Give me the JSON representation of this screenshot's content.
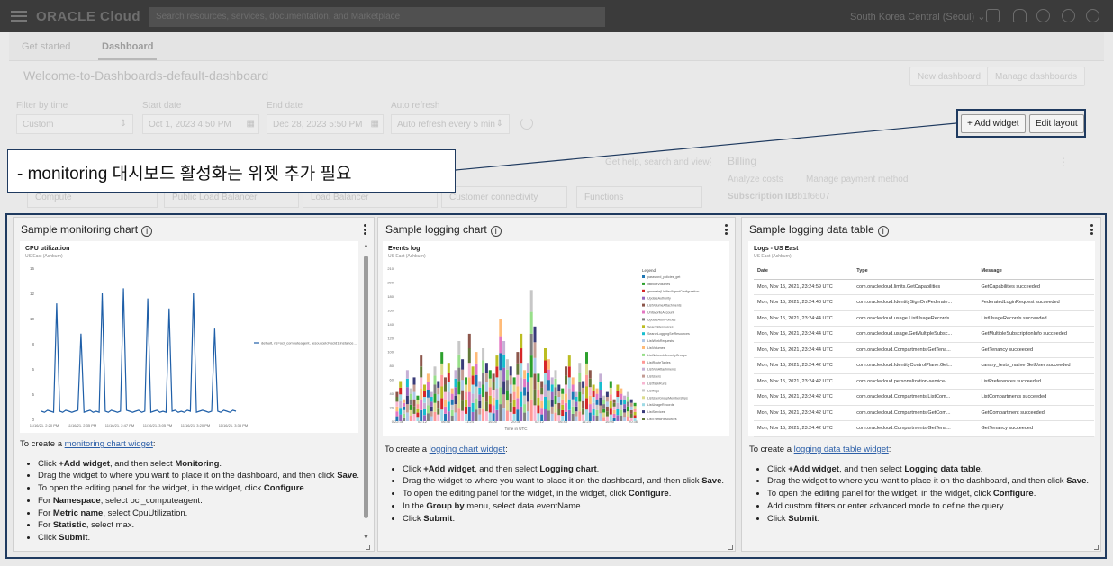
{
  "header": {
    "logo": "ORACLE Cloud",
    "search_placeholder": "Search resources, services, documentation, and Marketplace",
    "region": "South Korea Central (Seoul)"
  },
  "tabs": [
    "Get started",
    "Dashboard"
  ],
  "dashboard": {
    "title": "Welcome-to-Dashboards-default-dashboard",
    "new_dashboard_label": "New dashboard",
    "manage_dashboards_label": "Manage dashboards"
  },
  "filters": {
    "filter_by_time_label": "Filter by time",
    "filter_by_time_value": "Custom",
    "start_date_label": "Start date",
    "start_date_value": "Oct 1, 2023 4:50 PM",
    "end_date_label": "End date",
    "end_date_value": "Dec 28, 2023 5:50 PM",
    "auto_refresh_label": "Auto refresh",
    "auto_refresh_value": "Auto refresh every 5 min"
  },
  "toolbar": {
    "add_widget_label": "+ Add widget",
    "edit_layout_label": "Edit layout"
  },
  "callout": {
    "text": "- monitoring 대시보드 활성화는 위젯 추가 필요"
  },
  "background": {
    "link_text": "Get help, search and view",
    "billing_title": "Billing",
    "analyze_costs": "Analyze costs",
    "manage_payment": "Manage payment method",
    "subscription_label": "Subscription ID:",
    "subscription_value": "8b1f6607",
    "boxes": [
      "Compute",
      "Public Load Balancer",
      "Load Balancer",
      "Customer connectivity",
      "Functions"
    ]
  },
  "widgets": {
    "monitoring": {
      "title": "Sample monitoring chart",
      "chart_title": "CPU utilization",
      "chart_sub": "US East (Ashburn)",
      "legend": "default, ns=oci_computeagent, resourceId=ocid1.instance...",
      "yticks": [
        "15",
        "12",
        "10",
        "8",
        "6",
        "5",
        "0"
      ],
      "xticks": [
        "11/16/21, 2:20 PM",
        "11/16/21, 2:35 PM",
        "11/16/21, 2:47 PM",
        "11/16/21, 3:05 PM",
        "11/16/21, 3:20 PM",
        "11/16/21, 3:35 PM"
      ],
      "instructions_intro": "To create a ",
      "instructions_link": "monitoring chart widget",
      "instructions_colon": ":",
      "steps": [
        {
          "pre": "Click ",
          "b": "+Add widget",
          "post": ", and then select ",
          "b2": "Monitoring",
          "post2": "."
        },
        {
          "pre": "Drag the widget to where you want to place it on the dashboard, and then click ",
          "b": "Save",
          "post": ".",
          "b2": "",
          "post2": ""
        },
        {
          "pre": "To open the editing panel for the widget, in the widget, click ",
          "b": "Configure",
          "post": ".",
          "b2": "",
          "post2": ""
        },
        {
          "pre": "For ",
          "b": "Namespace",
          "post": ", select oci_computeagent.",
          "b2": "",
          "post2": ""
        },
        {
          "pre": "For ",
          "b": "Metric name",
          "post": ", select CpuUtilization.",
          "b2": "",
          "post2": ""
        },
        {
          "pre": "For ",
          "b": "Statistic",
          "post": ", select max.",
          "b2": "",
          "post2": ""
        },
        {
          "pre": "Click ",
          "b": "Submit",
          "post": ".",
          "b2": "",
          "post2": ""
        }
      ]
    },
    "logging": {
      "title": "Sample logging chart",
      "chart_title": "Events log",
      "chart_sub": "US East (Ashburn)",
      "legend_title": "Legend",
      "legend_items": [
        {
          "label": "password_policies_get",
          "color": "#1f77b4"
        },
        {
          "label": "listbootVolumes",
          "color": "#2ca02c"
        },
        {
          "label": "generate(UnifiedAgentConfiguration",
          "color": "#d62728"
        },
        {
          "label": "UpdateAuthority",
          "color": "#9467bd"
        },
        {
          "label": "ListVolumeAttachments",
          "color": "#8c564b"
        },
        {
          "label": "UnfavoriteAccount",
          "color": "#e377c2"
        },
        {
          "label": "UpdateAuthPolicies",
          "color": "#7f7f7f"
        },
        {
          "label": "SearchResources",
          "color": "#bcbd22"
        },
        {
          "label": "SearchLoggingSetResources",
          "color": "#17becf"
        },
        {
          "label": "ListWorkRequests",
          "color": "#aec7e8"
        },
        {
          "label": "ListVolumes",
          "color": "#ffbb78"
        },
        {
          "label": "ListNetworkSecurityGroups",
          "color": "#98df8a"
        },
        {
          "label": "ListRouteTables",
          "color": "#ff9896"
        },
        {
          "label": "ListVcnAttachments",
          "color": "#c5b0d5"
        },
        {
          "label": "ListUsers",
          "color": "#c49c94"
        },
        {
          "label": "ListTaskRuns",
          "color": "#f7b6d2"
        },
        {
          "label": "ListTags",
          "color": "#c7c7c7"
        },
        {
          "label": "ListUserGroupMemberships",
          "color": "#dbdb8d"
        },
        {
          "label": "ListUsageRecords",
          "color": "#9edae5"
        },
        {
          "label": "ListServices",
          "color": "#393b79"
        },
        {
          "label": "ListTrafficResources",
          "color": "#637939"
        }
      ],
      "yticks": [
        "210",
        "200",
        "180",
        "160",
        "140",
        "120",
        "100",
        "80",
        "60",
        "40",
        "20",
        "0"
      ],
      "xticks": [
        "22:36",
        "02:12",
        "06:48",
        "11:24",
        "16:00",
        "20:36",
        "02:12",
        "06:48",
        "11:24",
        "16:00",
        "20:36"
      ],
      "xlabel": "Time in UTC",
      "instructions_intro": "To create a ",
      "instructions_link": "logging chart widget",
      "instructions_colon": ":",
      "steps": [
        {
          "pre": "Click ",
          "b": "+Add widget",
          "post": ", and then select ",
          "b2": "Logging chart",
          "post2": "."
        },
        {
          "pre": "Drag the widget to where you want to place it on the dashboard, and then click ",
          "b": "Save",
          "post": ".",
          "b2": "",
          "post2": ""
        },
        {
          "pre": "To open the editing panel for the widget, in the widget, click ",
          "b": "Configure",
          "post": ".",
          "b2": "",
          "post2": ""
        },
        {
          "pre": "In the ",
          "b": "Group by",
          "post": " menu, select data.eventName.",
          "b2": "",
          "post2": ""
        },
        {
          "pre": "Click ",
          "b": "Submit",
          "post": ".",
          "b2": "",
          "post2": ""
        }
      ]
    },
    "table": {
      "title": "Sample logging data table",
      "chart_title": "Logs - US East",
      "chart_sub": "US East (Ashburn)",
      "columns": [
        "Date",
        "Type",
        "Message"
      ],
      "rows": [
        [
          "Mon, Nov 15, 2021, 23:24:59 UTC",
          "com.oraclecloud.limits.GetCapabilities",
          "GetCapabilities succeeded"
        ],
        [
          "Mon, Nov 15, 2021, 23:24:48 UTC",
          "com.oraclecloud.IdentitySignOn.Federate...",
          "FederatedLoginRequest succeeded"
        ],
        [
          "Mon, Nov 15, 2021, 23:24:44 UTC",
          "com.oraclecloud.usage.ListUsageRecords",
          "ListUsageRecords succeeded"
        ],
        [
          "Mon, Nov 15, 2021, 23:24:44 UTC",
          "com.oraclecloud.usage.GetMultipleSubsc...",
          "GetMultipleSubscriptionInfo succeeded"
        ],
        [
          "Mon, Nov 15, 2021, 23:24:44 UTC",
          "com.oraclecloud.Compartments.GetTena...",
          "GetTenancy succeeded"
        ],
        [
          "Mon, Nov 15, 2021, 23:24:42 UTC",
          "com.oraclecloud.IdentityControlPlane.Get...",
          "canary_tests_native GetUser succeeded"
        ],
        [
          "Mon, Nov 15, 2021, 23:24:42 UTC",
          "com.oraclecloud.personalization-service-...",
          "ListPreferences succeeded"
        ],
        [
          "Mon, Nov 15, 2021, 23:24:42 UTC",
          "com.oraclecloud.Compartments.ListCom...",
          "ListCompartments succeeded"
        ],
        [
          "Mon, Nov 15, 2021, 23:24:42 UTC",
          "com.oraclecloud.Compartments.GetCom...",
          "GetCompartment succeeded"
        ],
        [
          "Mon, Nov 15, 2021, 23:24:42 UTC",
          "com.oraclecloud.Compartments.GetTena...",
          "GetTenancy succeeded"
        ]
      ],
      "instructions_intro": "To create a ",
      "instructions_link": "logging data table widget",
      "instructions_colon": ":",
      "steps": [
        {
          "pre": "Click ",
          "b": "+Add widget",
          "post": ", and then select ",
          "b2": "Logging data table",
          "post2": "."
        },
        {
          "pre": "Drag the widget to where you want to place it on the dashboard, and then click ",
          "b": "Save",
          "post": ".",
          "b2": "",
          "post2": ""
        },
        {
          "pre": "To open the editing panel for the widget, in the widget, click ",
          "b": "Configure",
          "post": ".",
          "b2": "",
          "post2": ""
        },
        {
          "pre": "Add custom filters or enter advanced mode to define the query.",
          "b": "",
          "post": "",
          "b2": "",
          "post2": ""
        },
        {
          "pre": "Click ",
          "b": "Submit",
          "post": ".",
          "b2": "",
          "post2": ""
        }
      ]
    }
  },
  "chart_data": [
    {
      "type": "line",
      "title": "CPU utilization",
      "subtitle": "US East (Ashburn)",
      "ylim": [
        0,
        15
      ],
      "series": [
        {
          "name": "default, ns=oci_computeagent, resourceId=ocid1.instance...",
          "values": [
            0.8,
            0.7,
            0.9,
            0.8,
            0.7,
            11.5,
            0.8,
            0.7,
            0.9,
            0.8,
            0.7,
            0.8,
            0.9,
            8.5,
            0.7,
            0.8,
            0.9,
            0.7,
            0.8,
            0.7,
            12.5,
            0.8,
            0.7,
            0.9,
            0.8,
            0.7,
            0.8,
            13,
            0.9,
            0.8,
            0.7,
            0.8,
            0.9,
            0.7,
            0.8,
            12,
            0.7,
            0.8,
            0.9,
            0.7,
            0.8,
            0.7,
            11,
            0.8,
            0.9,
            0.7,
            0.8,
            0.7,
            0.9,
            0.8,
            12.5,
            0.7,
            0.8,
            0.9,
            0.8,
            0.7,
            0.8,
            9,
            0.8,
            0.7,
            0.9,
            0.8,
            0.7,
            0.9,
            0.8
          ]
        }
      ]
    },
    {
      "type": "bar",
      "title": "Events log",
      "subtitle": "US East (Ashburn)",
      "xlabel": "Time in UTC",
      "ylim": [
        0,
        210
      ],
      "values": [
        40,
        55,
        30,
        70,
        45,
        60,
        35,
        90,
        50,
        65,
        40,
        75,
        55,
        95,
        60,
        80,
        45,
        70,
        110,
        85,
        60,
        120,
        75,
        95,
        55,
        100,
        80,
        70,
        65,
        90,
        140,
        110,
        85,
        75,
        60,
        95,
        120,
        70,
        80,
        180,
        130,
        65,
        55,
        100,
        85,
        60,
        70,
        50,
        45,
        75,
        90,
        60,
        40,
        80,
        55,
        95,
        70,
        50,
        45,
        65,
        35,
        40,
        55,
        30,
        50,
        45,
        35,
        40,
        30,
        25
      ]
    }
  ]
}
